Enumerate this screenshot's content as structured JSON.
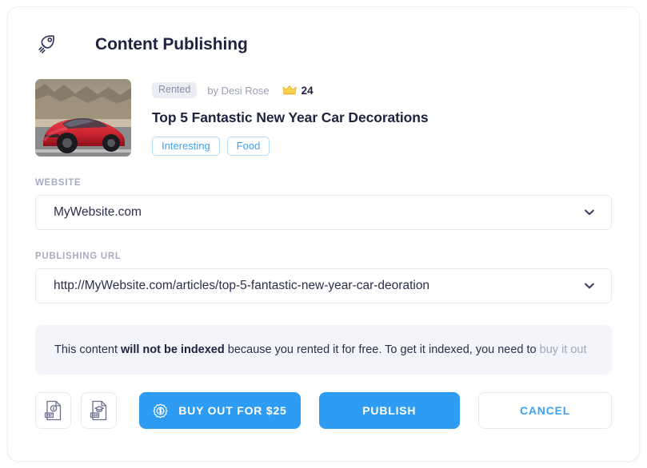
{
  "header": {
    "icon": "rocket-icon",
    "title": "Content Publishing"
  },
  "content": {
    "thumbnail_alt": "red-sports-car-thumbnail",
    "status_badge": "Rented",
    "author_line": "by Desi Rose",
    "crown_icon": "crown-icon",
    "crown_count": "24",
    "title": "Top 5 Fantastic New Year Car Decorations",
    "tags": [
      "Interesting",
      "Food"
    ]
  },
  "form": {
    "website": {
      "label": "WEBSITE",
      "value": "MyWebsite.com"
    },
    "publishing_url": {
      "label": "PUBLISHING URL",
      "value": "http://MyWebsite.com/articles/top-5-fantastic-new-year-car-deoration"
    }
  },
  "notice": {
    "prefix": "This content ",
    "bold": "will not be indexed",
    "middle": " because you rented it for free. To get it indexed, you need to ",
    "link": "buy it out"
  },
  "footer": {
    "pdf_icon": "pdf-file-icon",
    "doc_icon": "doc-file-icon",
    "buyout_label": "BUY OUT FOR $25",
    "buyout_icon": "dollar-seal-icon",
    "publish_label": "PUBLISH",
    "cancel_label": "CANCEL"
  },
  "colors": {
    "accent_blue": "#2f9cf4",
    "link_blue": "#3ea1f4",
    "text_dark": "#1f2340",
    "label_gray": "#a8abc4",
    "notice_bg": "#f4f5fa",
    "badge_bg": "#ecedf3",
    "crown_gold": "#f5c53d"
  }
}
